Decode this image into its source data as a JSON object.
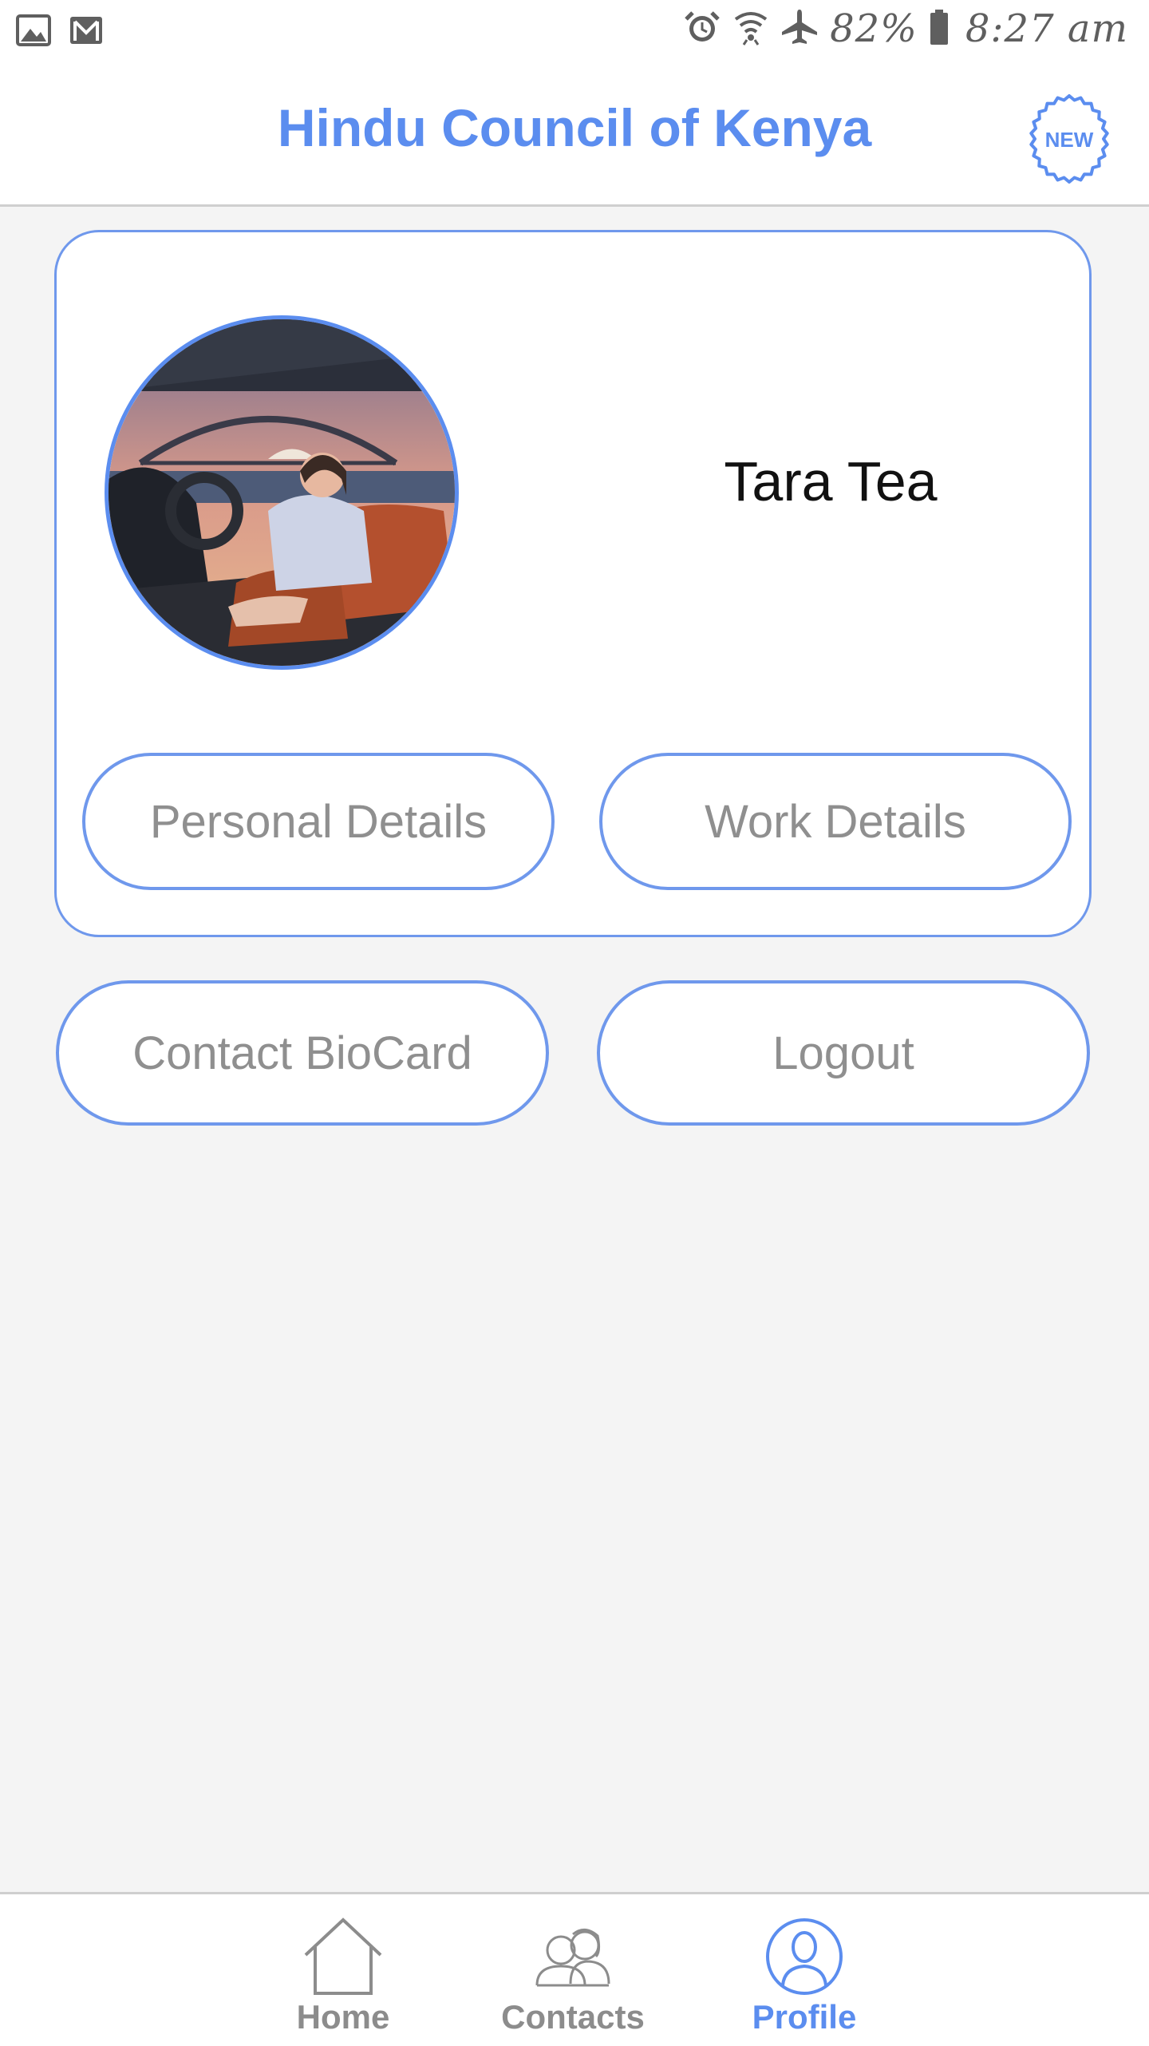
{
  "status_bar": {
    "left_icons": [
      "image-icon",
      "gmail-icon"
    ],
    "right_icons": [
      "alarm-icon",
      "wifi-icon",
      "airplane-icon",
      "battery-icon"
    ],
    "battery_percent": "82%",
    "time": "8:27 am"
  },
  "header": {
    "title": "Hindu Council of Kenya",
    "badge": "NEW"
  },
  "profile": {
    "name": "Tara Tea",
    "avatar_icon": "profile-photo"
  },
  "buttons": {
    "personal_details": "Personal Details",
    "work_details": "Work Details",
    "contact_biocard": "Contact BioCard",
    "logout": "Logout"
  },
  "bottom_nav": {
    "items": [
      {
        "label": "Home",
        "icon": "home-icon"
      },
      {
        "label": "Contacts",
        "icon": "contacts-icon"
      },
      {
        "label": "Profile",
        "icon": "profile-icon"
      }
    ],
    "active": "Profile"
  },
  "colors": {
    "accent": "#5b8def",
    "border": "#6f98ec",
    "inactive": "#8c8c8c",
    "background": "#f4f4f4"
  }
}
